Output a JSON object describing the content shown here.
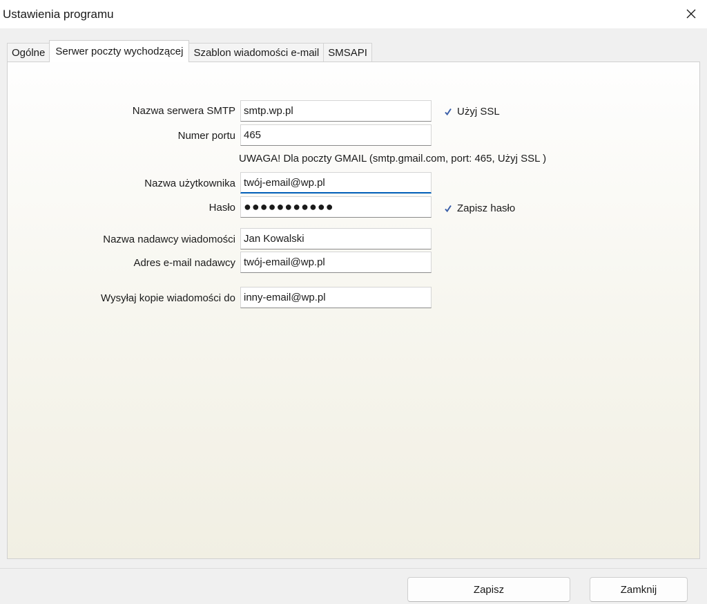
{
  "window": {
    "title": "Ustawienia programu"
  },
  "tabs": [
    {
      "label": "Ogólne",
      "active": false
    },
    {
      "label": "Serwer poczty wychodzącej",
      "active": true
    },
    {
      "label": "Szablon wiadomości e-mail",
      "active": false
    },
    {
      "label": "SMSAPI",
      "active": false
    }
  ],
  "form": {
    "smtp_server": {
      "label": "Nazwa serwera SMTP",
      "value": "smtp.wp.pl"
    },
    "port": {
      "label": "Numer portu",
      "value": "465"
    },
    "gmail_note": "UWAGA! Dla poczty GMAIL (smtp.gmail.com, port: 465, Użyj SSL )",
    "username": {
      "label": "Nazwa użytkownika",
      "value": "twój-email@wp.pl"
    },
    "password": {
      "label": "Hasło",
      "value": "●●●●●●●●●●●"
    },
    "sender_name": {
      "label": "Nazwa nadawcy wiadomości",
      "value": "Jan Kowalski"
    },
    "sender_email": {
      "label": "Adres e-mail nadawcy",
      "value": "twój-email@wp.pl"
    },
    "copy_to": {
      "label": "Wysyłaj kopie wiadomości do",
      "value": "inny-email@wp.pl"
    },
    "use_ssl": {
      "label": "Użyj SSL",
      "checked": true
    },
    "save_password": {
      "label": "Zapisz hasło",
      "checked": true
    }
  },
  "buttons": {
    "save": "Zapisz",
    "close": "Zamknij"
  },
  "colors": {
    "focus_accent": "#005fb8",
    "check_mark": "#3a5ea8"
  },
  "icons": {
    "close": "close-icon",
    "checkbox": "checkmark-icon"
  }
}
